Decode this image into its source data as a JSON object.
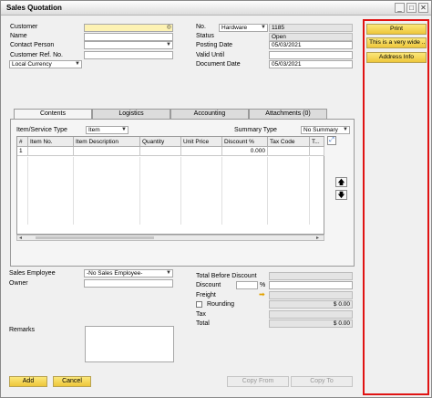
{
  "window": {
    "title": "Sales Quotation",
    "minimize": "_",
    "maximize": "□",
    "close": "✕"
  },
  "header_left": {
    "customer_label": "Customer",
    "name_label": "Name",
    "contact_label": "Contact Person",
    "ref_label": "Customer Ref. No.",
    "currency_value": "Local Currency",
    "customer_icon": "choose-from-list-icon"
  },
  "header_right": {
    "no_label": "No.",
    "series_value": "Hardware",
    "no_value": "1185",
    "status_label": "Status",
    "status_value": "Open",
    "posting_label": "Posting Date",
    "posting_value": "05/03/2021",
    "valid_label": "Valid Until",
    "valid_value": "",
    "docdate_label": "Document Date",
    "docdate_value": "05/03/2021"
  },
  "tabs": [
    "Contents",
    "Logistics",
    "Accounting",
    "Attachments (0)"
  ],
  "contents": {
    "type_label": "Item/Service Type",
    "type_value": "Item",
    "summary_label": "Summary Type",
    "summary_value": "No Summary",
    "columns": [
      "#",
      "Item No.",
      "Item Description",
      "Quantity",
      "Unit Price",
      "Discount %",
      "Tax Code",
      "T..."
    ],
    "rows": [
      {
        "num": "1",
        "discount": "0.000"
      }
    ]
  },
  "footer_left": {
    "employee_label": "Sales Employee",
    "employee_value": "-No Sales Employee-",
    "owner_label": "Owner",
    "remarks_label": "Remarks"
  },
  "footer_right": {
    "total_before_label": "Total Before Discount",
    "discount_label": "Discount",
    "discount_pct": "%",
    "freight_label": "Freight",
    "rounding_label": "Rounding",
    "rounding_value": "$ 0.00",
    "tax_label": "Tax",
    "total_label": "Total",
    "total_value": "$ 0.00"
  },
  "buttons": {
    "add": "Add",
    "cancel": "Cancel",
    "copy_from": "Copy From",
    "copy_to": "Copy To"
  },
  "side_panel": {
    "print": "Print",
    "wide": "This is a very wide ...",
    "address": "Address Info"
  },
  "colors": {
    "accent": "#f3d047",
    "field_yellow": "#fdf2b3",
    "highlight_border": "#e01313"
  }
}
